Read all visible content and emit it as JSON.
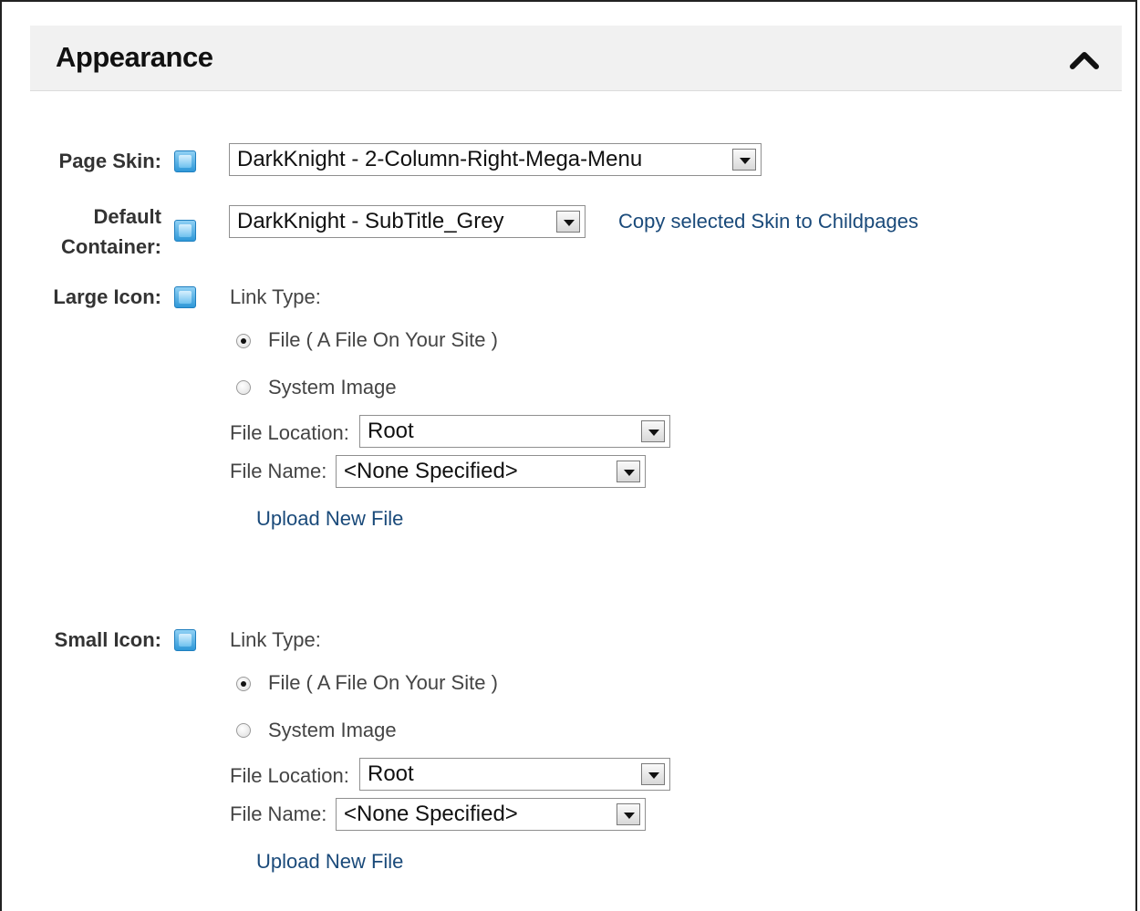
{
  "section": {
    "title": "Appearance"
  },
  "page_skin": {
    "label": "Page Skin:",
    "value": "DarkKnight - 2-Column-Right-Mega-Menu"
  },
  "default_container": {
    "label_line1": "Default",
    "label_line2": "Container:",
    "value": "DarkKnight - SubTitle_Grey",
    "copy_link": "Copy selected Skin to Childpages"
  },
  "large_icon": {
    "label": "Large Icon:",
    "link_type_label": "Link Type:",
    "options": [
      "File ( A File On Your Site )",
      "System Image"
    ],
    "selected_option": "File ( A File On Your Site )",
    "file_location_label": "File Location:",
    "file_location_value": "Root",
    "file_name_label": "File Name:",
    "file_name_value": "<None Specified>",
    "upload_link": "Upload New File"
  },
  "small_icon": {
    "label": "Small Icon:",
    "link_type_label": "Link Type:",
    "options": [
      "File ( A File On Your Site )",
      "System Image"
    ],
    "selected_option": "File ( A File On Your Site )",
    "file_location_label": "File Location:",
    "file_location_value": "Root",
    "file_name_label": "File Name:",
    "file_name_value": "<None Specified>",
    "upload_link": "Upload New File"
  },
  "icons": {
    "collapse": "chevron-up-icon",
    "help": "help-icon",
    "dropdown": "chevron-down-icon"
  },
  "colors": {
    "link": "#1a4a7a",
    "header_bg": "#f1f1f1",
    "help_icon": "#2f98d8"
  }
}
